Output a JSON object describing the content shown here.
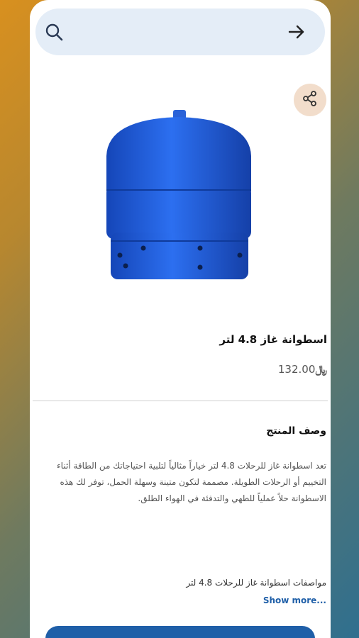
{
  "search": {
    "placeholder": "",
    "search_icon": "search-icon",
    "go_icon": "arrow-right-icon"
  },
  "product": {
    "share_icon": "share-icon",
    "title": "اسطوانة غاز 4.8 لتر",
    "price": "132.00",
    "currency_symbol": "﷼",
    "description_heading": "وصف المنتج",
    "description": "تعد اسطوانة غاز للرحلات 4.8 لتر خياراً مثالياً لتلبية احتياجاتك من الطاقة أثناء التخييم أو الرحلات الطويلة. مصممة لتكون متينة وسهلة الحمل، توفر لك هذه الاسطوانة حلاً عملياً للطهي والتدفئة في الهواء الطلق.",
    "specs_line": "مواصفات اسطوانة غاز للرحلات 4.8 لتر",
    "show_more": "Show more..."
  },
  "colors": {
    "accent": "#1f5fa8",
    "search_bg": "#e4edf7",
    "share_bg": "#f2ddcb",
    "cylinder_blue": "#1e5fd6"
  }
}
